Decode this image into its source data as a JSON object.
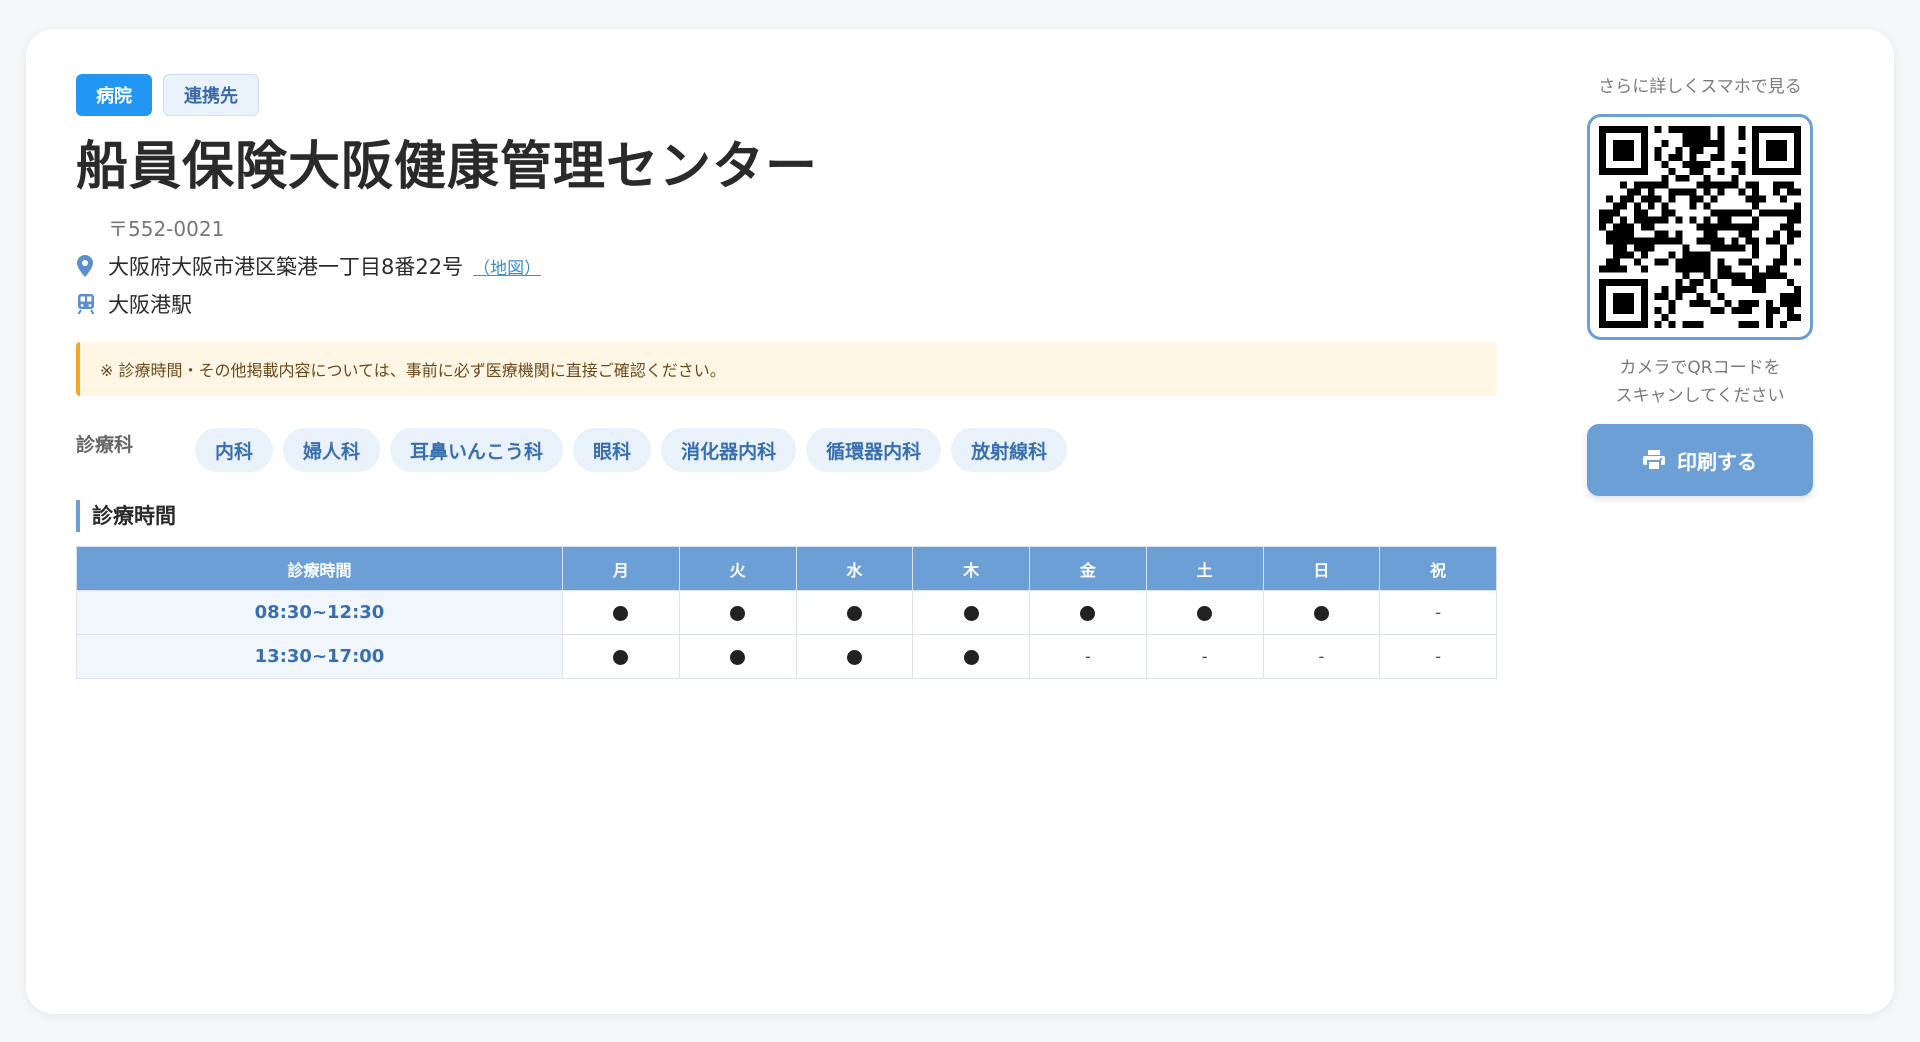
{
  "tags": [
    "病院",
    "連携先"
  ],
  "facility": {
    "name": "船員保険大阪健康管理センター",
    "postal": "〒552-0021",
    "address": "大阪府大阪市港区築港一丁目8番22号",
    "map_link": "（地図）",
    "station": "大阪港駅"
  },
  "notice": "※ 診療時間・その他掲載内容については、事前に必ず医療機関に直接ご確認ください。",
  "departments": {
    "label": "診療科",
    "items": [
      "内科",
      "婦人科",
      "耳鼻いんこう科",
      "眼科",
      "消化器内科",
      "循環器内科",
      "放射線科"
    ]
  },
  "hours": {
    "heading": "診療時間",
    "columns": [
      "診療時間",
      "月",
      "火",
      "水",
      "木",
      "金",
      "土",
      "日",
      "祝"
    ],
    "rows": [
      {
        "time": "08:30~12:30",
        "days": [
          "●",
          "●",
          "●",
          "●",
          "●",
          "●",
          "●",
          "-"
        ]
      },
      {
        "time": "13:30~17:00",
        "days": [
          "●",
          "●",
          "●",
          "●",
          "-",
          "-",
          "-",
          "-"
        ]
      }
    ]
  },
  "side": {
    "caption_top": "さらに詳しくスマホで見る",
    "caption_bottom_1": "カメラでQRコードを",
    "caption_bottom_2": "スキャンしてください",
    "print_label": "印刷する"
  },
  "colors": {
    "accent": "#6b9fd6",
    "tag_primary": "#2196f3",
    "notice_border": "#f5a623"
  }
}
